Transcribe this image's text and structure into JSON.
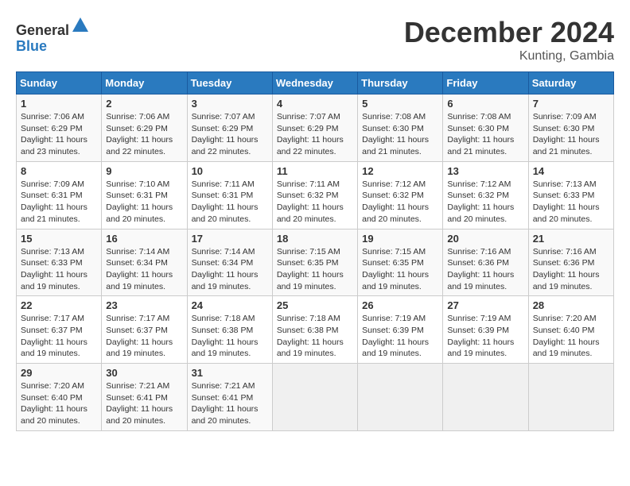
{
  "header": {
    "logo_line1": "General",
    "logo_line2": "Blue",
    "title": "December 2024",
    "subtitle": "Kunting, Gambia"
  },
  "calendar": {
    "days_of_week": [
      "Sunday",
      "Monday",
      "Tuesday",
      "Wednesday",
      "Thursday",
      "Friday",
      "Saturday"
    ],
    "weeks": [
      [
        {
          "day": null
        },
        {
          "day": null
        },
        {
          "day": null
        },
        {
          "day": null
        },
        {
          "day": null
        },
        {
          "day": null
        },
        {
          "day": null
        }
      ]
    ],
    "cells": [
      {
        "date": 1,
        "dow": 0,
        "sunrise": "7:06 AM",
        "sunset": "6:29 PM",
        "daylight": "11 hours and 23 minutes."
      },
      {
        "date": 2,
        "dow": 1,
        "sunrise": "7:06 AM",
        "sunset": "6:29 PM",
        "daylight": "11 hours and 22 minutes."
      },
      {
        "date": 3,
        "dow": 2,
        "sunrise": "7:07 AM",
        "sunset": "6:29 PM",
        "daylight": "11 hours and 22 minutes."
      },
      {
        "date": 4,
        "dow": 3,
        "sunrise": "7:07 AM",
        "sunset": "6:29 PM",
        "daylight": "11 hours and 22 minutes."
      },
      {
        "date": 5,
        "dow": 4,
        "sunrise": "7:08 AM",
        "sunset": "6:30 PM",
        "daylight": "11 hours and 21 minutes."
      },
      {
        "date": 6,
        "dow": 5,
        "sunrise": "7:08 AM",
        "sunset": "6:30 PM",
        "daylight": "11 hours and 21 minutes."
      },
      {
        "date": 7,
        "dow": 6,
        "sunrise": "7:09 AM",
        "sunset": "6:30 PM",
        "daylight": "11 hours and 21 minutes."
      },
      {
        "date": 8,
        "dow": 0,
        "sunrise": "7:09 AM",
        "sunset": "6:31 PM",
        "daylight": "11 hours and 21 minutes."
      },
      {
        "date": 9,
        "dow": 1,
        "sunrise": "7:10 AM",
        "sunset": "6:31 PM",
        "daylight": "11 hours and 20 minutes."
      },
      {
        "date": 10,
        "dow": 2,
        "sunrise": "7:11 AM",
        "sunset": "6:31 PM",
        "daylight": "11 hours and 20 minutes."
      },
      {
        "date": 11,
        "dow": 3,
        "sunrise": "7:11 AM",
        "sunset": "6:32 PM",
        "daylight": "11 hours and 20 minutes."
      },
      {
        "date": 12,
        "dow": 4,
        "sunrise": "7:12 AM",
        "sunset": "6:32 PM",
        "daylight": "11 hours and 20 minutes."
      },
      {
        "date": 13,
        "dow": 5,
        "sunrise": "7:12 AM",
        "sunset": "6:32 PM",
        "daylight": "11 hours and 20 minutes."
      },
      {
        "date": 14,
        "dow": 6,
        "sunrise": "7:13 AM",
        "sunset": "6:33 PM",
        "daylight": "11 hours and 20 minutes."
      },
      {
        "date": 15,
        "dow": 0,
        "sunrise": "7:13 AM",
        "sunset": "6:33 PM",
        "daylight": "11 hours and 19 minutes."
      },
      {
        "date": 16,
        "dow": 1,
        "sunrise": "7:14 AM",
        "sunset": "6:34 PM",
        "daylight": "11 hours and 19 minutes."
      },
      {
        "date": 17,
        "dow": 2,
        "sunrise": "7:14 AM",
        "sunset": "6:34 PM",
        "daylight": "11 hours and 19 minutes."
      },
      {
        "date": 18,
        "dow": 3,
        "sunrise": "7:15 AM",
        "sunset": "6:35 PM",
        "daylight": "11 hours and 19 minutes."
      },
      {
        "date": 19,
        "dow": 4,
        "sunrise": "7:15 AM",
        "sunset": "6:35 PM",
        "daylight": "11 hours and 19 minutes."
      },
      {
        "date": 20,
        "dow": 5,
        "sunrise": "7:16 AM",
        "sunset": "6:36 PM",
        "daylight": "11 hours and 19 minutes."
      },
      {
        "date": 21,
        "dow": 6,
        "sunrise": "7:16 AM",
        "sunset": "6:36 PM",
        "daylight": "11 hours and 19 minutes."
      },
      {
        "date": 22,
        "dow": 0,
        "sunrise": "7:17 AM",
        "sunset": "6:37 PM",
        "daylight": "11 hours and 19 minutes."
      },
      {
        "date": 23,
        "dow": 1,
        "sunrise": "7:17 AM",
        "sunset": "6:37 PM",
        "daylight": "11 hours and 19 minutes."
      },
      {
        "date": 24,
        "dow": 2,
        "sunrise": "7:18 AM",
        "sunset": "6:38 PM",
        "daylight": "11 hours and 19 minutes."
      },
      {
        "date": 25,
        "dow": 3,
        "sunrise": "7:18 AM",
        "sunset": "6:38 PM",
        "daylight": "11 hours and 19 minutes."
      },
      {
        "date": 26,
        "dow": 4,
        "sunrise": "7:19 AM",
        "sunset": "6:39 PM",
        "daylight": "11 hours and 19 minutes."
      },
      {
        "date": 27,
        "dow": 5,
        "sunrise": "7:19 AM",
        "sunset": "6:39 PM",
        "daylight": "11 hours and 19 minutes."
      },
      {
        "date": 28,
        "dow": 6,
        "sunrise": "7:20 AM",
        "sunset": "6:40 PM",
        "daylight": "11 hours and 19 minutes."
      },
      {
        "date": 29,
        "dow": 0,
        "sunrise": "7:20 AM",
        "sunset": "6:40 PM",
        "daylight": "11 hours and 20 minutes."
      },
      {
        "date": 30,
        "dow": 1,
        "sunrise": "7:21 AM",
        "sunset": "6:41 PM",
        "daylight": "11 hours and 20 minutes."
      },
      {
        "date": 31,
        "dow": 2,
        "sunrise": "7:21 AM",
        "sunset": "6:41 PM",
        "daylight": "11 hours and 20 minutes."
      }
    ]
  }
}
